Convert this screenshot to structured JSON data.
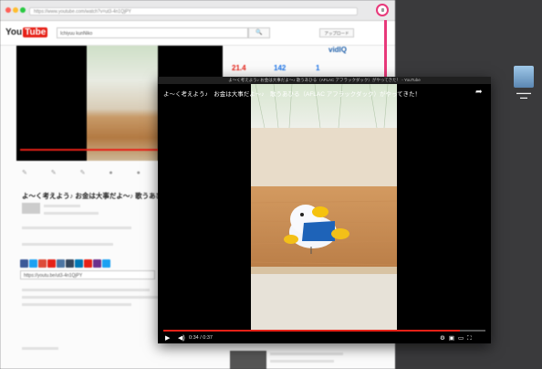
{
  "browser": {
    "url": "https://www.youtube.com/watch?v=ut3-4n1QjPY",
    "search_value": "Ichiyuu kunNiko",
    "search_button": "🔍",
    "upload_label": "アップロード",
    "logo_you": "You",
    "logo_tube": "Tube"
  },
  "background_video": {
    "title": "よ～く考えよう♪ お金は大事だよ～♪ 歌うあひる",
    "share_url": "https://youtu.be/ut3-4n1QjPY",
    "stats": [
      "21.4",
      "142",
      "1"
    ],
    "vidiq": "vidIQ"
  },
  "cast_window": {
    "window_title": "よ～く考えよう♪ お金は大事だよ～♪ 歌うあひる（AFLAC アフラックダック）がやってきた！ - YouTube",
    "video_title": "よ～く考えよう♪　お金は大事だよ～♪　歌うあひる（AFLAC アフラックダック）がやってきた！",
    "time": "0:34 / 0:37",
    "progress": 0.92
  },
  "colors": {
    "accent": "#e8397a",
    "youtube_red": "#e62117"
  }
}
